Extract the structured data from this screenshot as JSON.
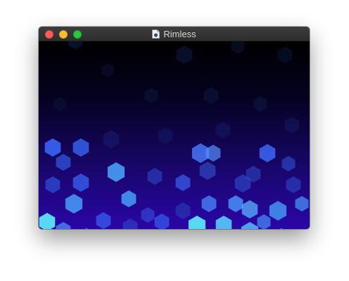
{
  "window": {
    "title": "Rimless",
    "title_icon": "document-icon"
  },
  "titlebar_buttons": [
    {
      "name": "close",
      "color": "#fe5f57"
    },
    {
      "name": "minimize",
      "color": "#febc2e"
    },
    {
      "name": "zoom",
      "color": "#28c840"
    }
  ],
  "content": {
    "kind": "bokeh-animation",
    "background_colors": [
      "#000000",
      "#150660",
      "#2a06a8"
    ],
    "particle_colors": [
      "#1a3a8a",
      "#3a6bff",
      "#4aa8ff",
      "#5ef0ff",
      "#6e6ae0"
    ]
  }
}
